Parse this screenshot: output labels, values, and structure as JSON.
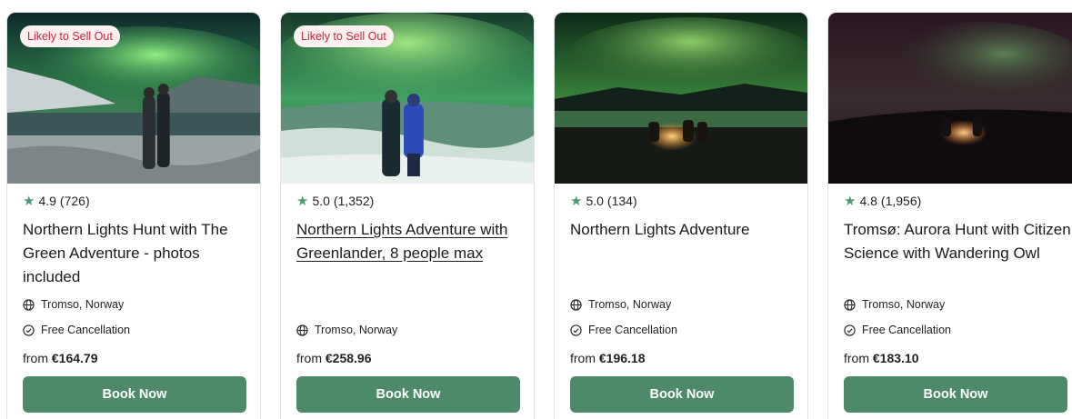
{
  "cards": [
    {
      "badge": "Likely to Sell Out",
      "rating": "4.9",
      "reviews": "(726)",
      "title": "Northern Lights Hunt with The Green Adventure - photos included",
      "location": "Tromso, Norway",
      "cancellation": "Free Cancellation",
      "price_prefix": "from",
      "price": "€164.79",
      "button": "Book Now"
    },
    {
      "badge": "Likely to Sell Out",
      "rating": "5.0",
      "reviews": "(1,352)",
      "title": "Northern Lights Adventure with Greenlander, 8 people max",
      "location": "Tromso, Norway",
      "price_prefix": "from",
      "price": "€258.96",
      "button": "Book Now"
    },
    {
      "rating": "5.0",
      "reviews": "(134)",
      "title": "Northern Lights Adventure",
      "location": "Tromso, Norway",
      "cancellation": "Free Cancellation",
      "price_prefix": "from",
      "price": "€196.18",
      "button": "Book Now"
    },
    {
      "rating": "4.8",
      "reviews": "(1,956)",
      "title": "Tromsø: Aurora Hunt with Citizen Science with Wandering Owl",
      "location": "Tromso, Norway",
      "cancellation": "Free Cancellation",
      "price_prefix": "from",
      "price": "€183.10",
      "button": "Book Now"
    }
  ],
  "colors": {
    "button_green": "#4c8a6a",
    "star_green": "#4f9a77",
    "badge_text": "#c8243a",
    "badge_bg": "#fdf0f1"
  },
  "icons": {
    "star": "star-icon",
    "location": "globe-icon",
    "cancellation": "check-circle-icon"
  }
}
